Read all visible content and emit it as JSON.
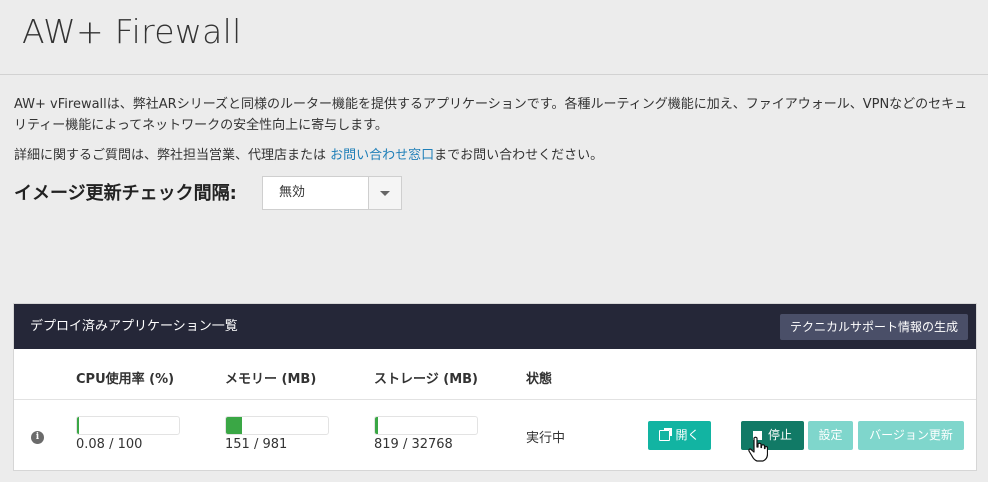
{
  "page": {
    "title": "AW+ Firewall",
    "description": "AW+ vFirewallは、弊社ARシリーズと同様のルーター機能を提供するアプリケーションです。各種ルーティング機能に加え、ファイアウォール、VPNなどのセキュリティー機能によってネットワークの安全性向上に寄与します。",
    "contact_prefix": "詳細に関するご質問は、弊社担当営業、代理店または ",
    "contact_link": "お問い合わせ窓口",
    "contact_suffix": "までお問い合わせください。"
  },
  "image_check": {
    "label": "イメージ更新チェック間隔:",
    "selected": "無効"
  },
  "panel": {
    "title": "デプロイ済みアプリケーション一覧",
    "support_button": "テクニカルサポート情報の生成",
    "columns": {
      "cpu": "CPU使用率 (%)",
      "memory": "メモリー (MB)",
      "storage": "ストレージ (MB)",
      "status": "状態"
    },
    "row": {
      "cpu_value": "0.08 / 100",
      "cpu_fraction": 0.0008,
      "memory_value": "151 / 981",
      "memory_fraction": 0.154,
      "storage_value": "819 / 32768",
      "storage_fraction": 0.025,
      "status": "実行中",
      "open_button": "開く",
      "stop_button": "停止",
      "config_button": "設定",
      "update_button": "バージョン更新"
    }
  },
  "colors": {
    "header_bg": "#252738",
    "bar_fill": "#3aa745",
    "primary_teal": "#12b4a2",
    "stop_teal": "#117a66",
    "light_teal": "#7fd6cc",
    "link": "#1f7fb8"
  },
  "icons": {
    "info": "info-circle-icon",
    "open": "external-link-icon",
    "stop": "stop-square-icon",
    "select": "caret-down-icon",
    "cursor": "hand-pointer-icon"
  }
}
